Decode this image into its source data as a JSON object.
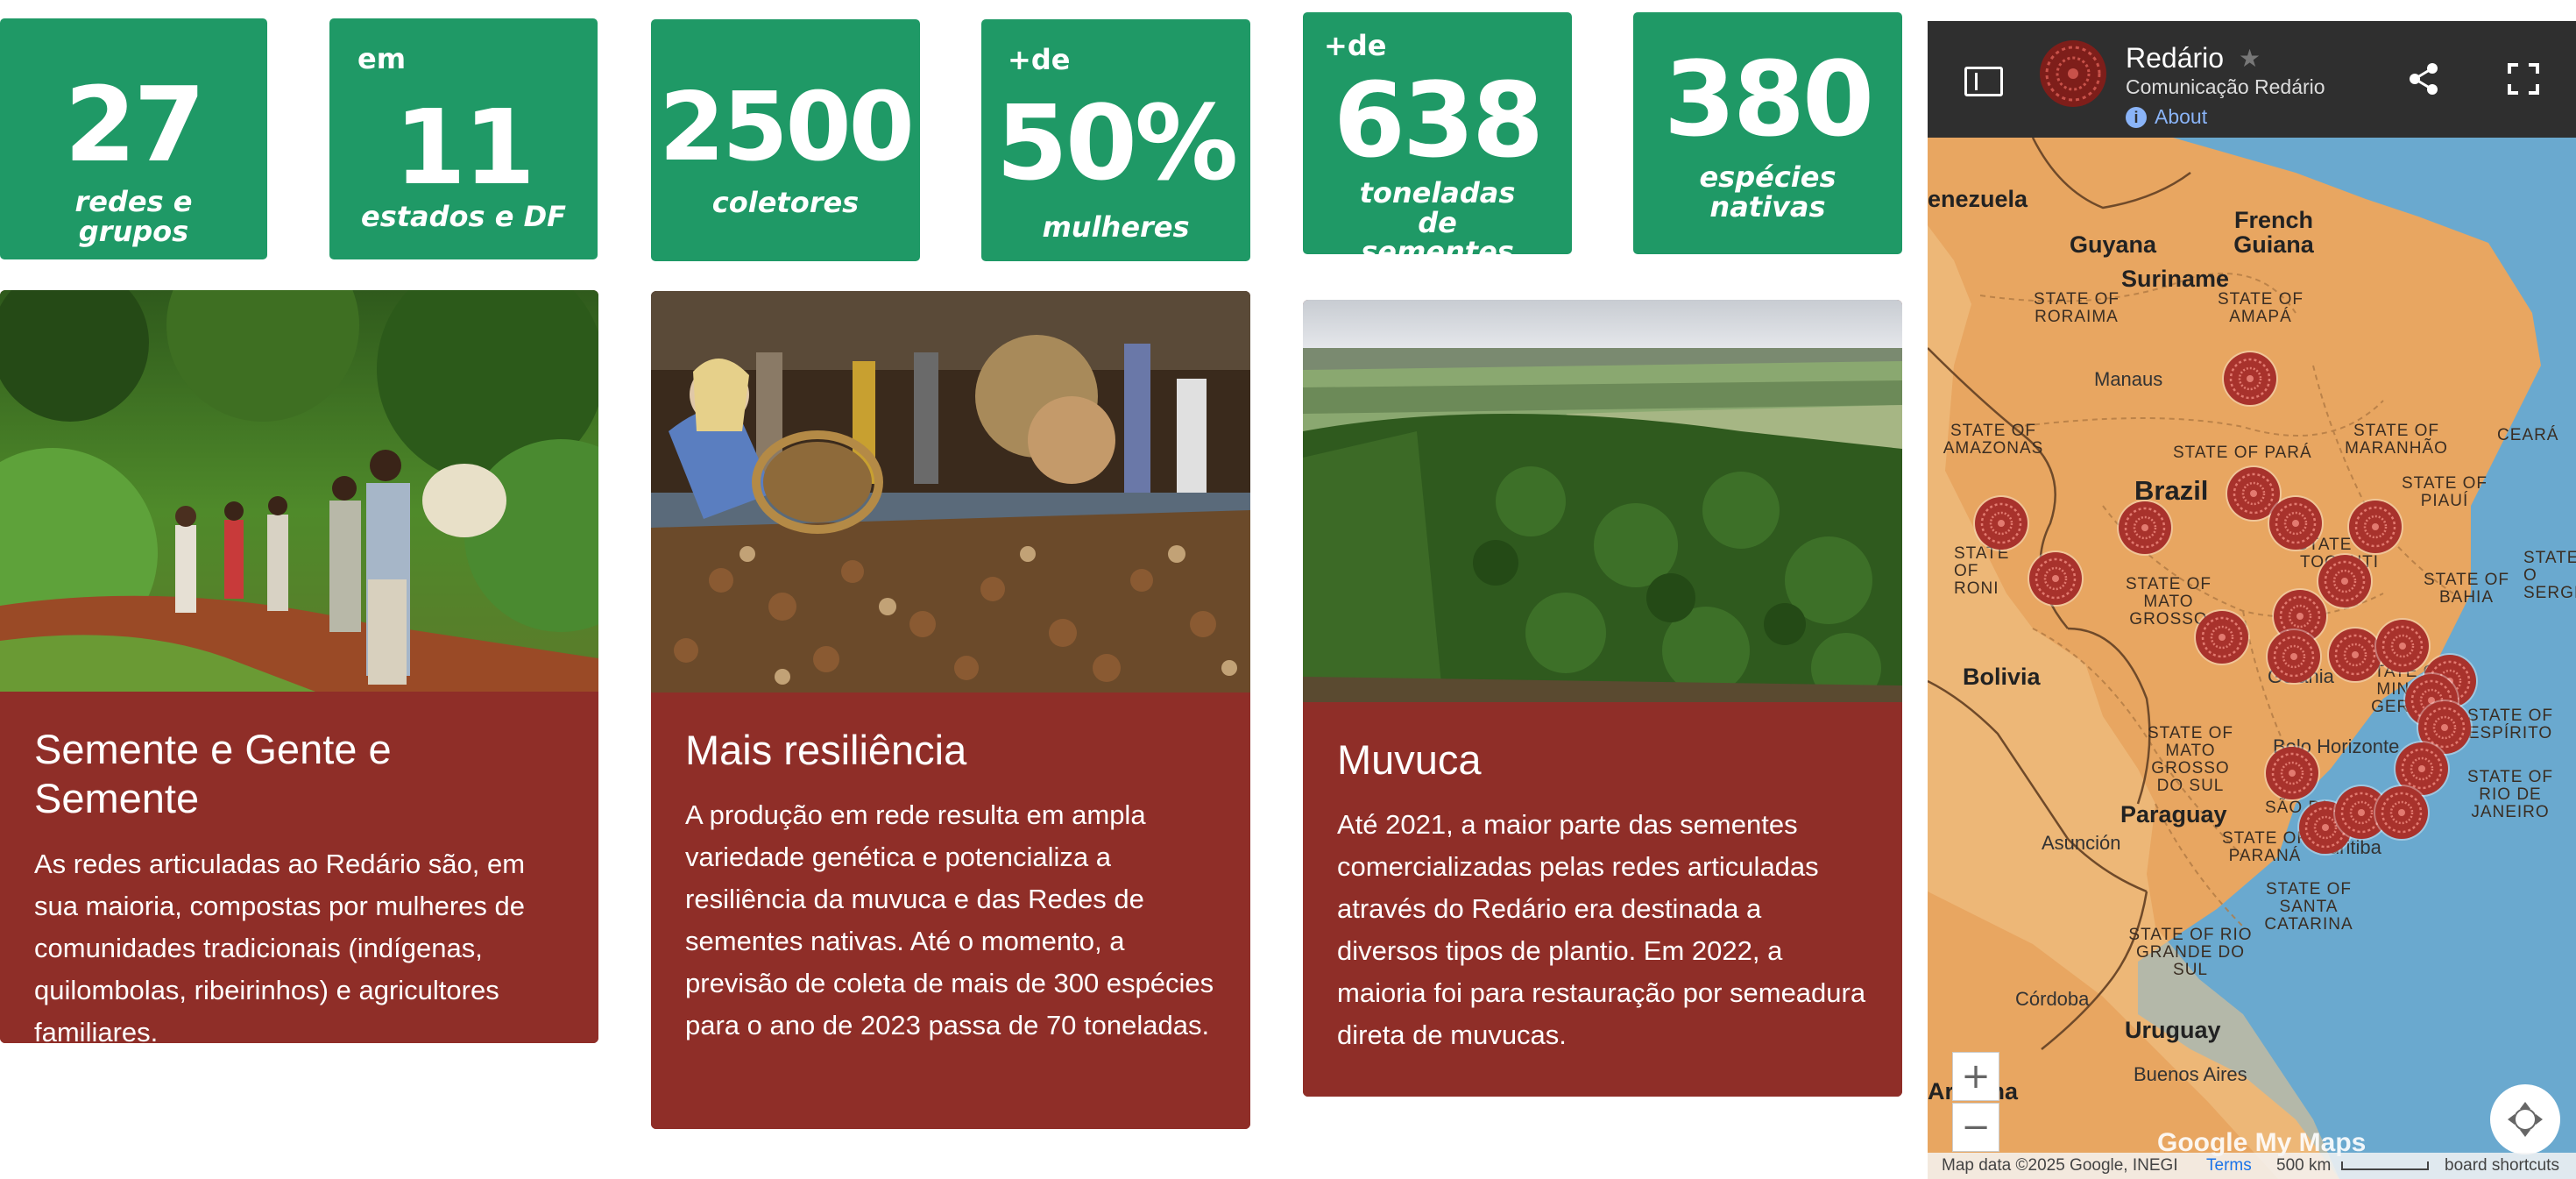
{
  "stats": [
    {
      "prefix": "",
      "number": "27",
      "caption": "redes e grupos"
    },
    {
      "prefix": "em",
      "number": "11",
      "caption": "estados e DF"
    },
    {
      "prefix": "",
      "number": "2500",
      "caption": "coletores"
    },
    {
      "prefix": "+de",
      "number": "50%",
      "caption": "mulheres"
    },
    {
      "prefix": "+de",
      "number": "638",
      "caption": "toneladas de sementes"
    },
    {
      "prefix": "",
      "number": "380",
      "caption": "espécies nativas"
    }
  ],
  "cards": [
    {
      "title": "Semente e Gente e Semente",
      "text": "As redes articuladas ao Redário são, em sua maioria, compostas por mulheres de comunidades tradicionais (indígenas, quilombolas, ribeirinhos) e agricultores familiares."
    },
    {
      "title": "Mais resiliência",
      "text": "A produção em rede resulta em ampla variedade genética e potencializa a resiliência da muvuca e das Redes de sementes nativas. Até o momento, a previsão de coleta de mais de 300 espécies para o ano de 2023 passa de 70 toneladas."
    },
    {
      "title": "Muvuca",
      "text": "Até 2021, a maior parte das sementes comercializadas pelas redes articuladas através do Redário era destinada a diversos tipos de plantio. Em 2022, a maioria foi para restauração por semeadura direta de muvucas."
    }
  ],
  "map": {
    "title": "Redário",
    "subtitle": "Comunicação Redário",
    "about": "About",
    "countries": {
      "venezuela": "enezuela",
      "guyana": "Guyana",
      "french_guiana": "French Guiana",
      "suriname": "Suriname",
      "brazil": "Brazil",
      "bolivia": "Bolivia",
      "paraguay": "Paraguay",
      "uruguay": "Uruguay",
      "argentina_a": "Ar",
      "argentina_b": "tina"
    },
    "states": {
      "roraima": "STATE OF RORAIMA",
      "amapa": "STATE OF AMAPÁ",
      "amazonas": "STATE OF AMAZONAS",
      "para": "STATE OF PARÁ",
      "maranhao": "STATE OF MARANHÃO",
      "ceara": "CEARÁ",
      "piaui": "STATE OF PIAUÍ",
      "tocantins": "STATE OF TOCANTI",
      "rondonia": "STATE OF RONI",
      "mato_grosso": "STATE OF MATO GROSSO",
      "bahia": "STATE OF BAHIA",
      "minas": "STATE OF MINAS GERAIS",
      "espirito": "STATE OF ESPÍRITO",
      "sergipe": "STATE O SERGIPE",
      "ms": "STATE OF MATO GROSSO DO SUL",
      "rio": "STATE OF RIO DE JANEIRO",
      "sao_paulo": "SÃO PA",
      "parana": "STATE OF PARANÁ",
      "santa_catarina": "STATE OF SANTA CATARINA",
      "rgs": "STATE OF RIO GRANDE DO SUL"
    },
    "cities": {
      "manaus": "Manaus",
      "goiania": "Goiânia",
      "belo_horizonte": "Belo Horizonte",
      "asuncion": "Asunción",
      "curitiba": "Curitiba",
      "cordoba": "Córdoba",
      "buenos_aires": "Buenos Aires"
    },
    "zoom_in": "+",
    "zoom_out": "−",
    "logo": "Google My Maps",
    "attribution": "Map data ©2025 Google, INEGI",
    "terms": "Terms",
    "scale": "500 km",
    "shortcuts": "board shortcuts",
    "colors": {
      "land": "#e8a661",
      "ocean": "#6aa9cf",
      "marker": "#a8322c",
      "header": "#2f2f2f",
      "tile": "#1f9966",
      "card": "#8f2e28"
    }
  }
}
